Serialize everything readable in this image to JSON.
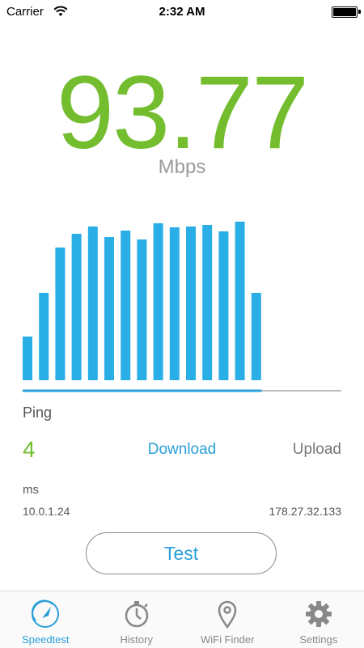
{
  "status_bar": {
    "carrier": "Carrier",
    "time": "2:32 AM"
  },
  "speed": {
    "value": "93.77",
    "unit": "Mbps"
  },
  "chart_data": {
    "type": "bar",
    "values": [
      54,
      108,
      164,
      181,
      190,
      177,
      185,
      174,
      194,
      189,
      190,
      192,
      184,
      196,
      108
    ],
    "progress": 0.75,
    "bar_color": "#2aaee6",
    "progress_color": "#2a9fd8",
    "track_color": "#bdbdbd"
  },
  "stats": {
    "ping_label": "Ping",
    "ping_value": "4",
    "download_label": "Download",
    "upload_label": "Upload",
    "ms_label": "ms",
    "local_ip": "10.0.1.24",
    "server_ip": "178.27.32.133"
  },
  "test_button": {
    "label": "Test"
  },
  "tabs": [
    {
      "label": "Speedtest",
      "icon": "speedtest-gauge-icon",
      "active": true
    },
    {
      "label": "History",
      "icon": "stopwatch-icon",
      "active": false
    },
    {
      "label": "WiFi Finder",
      "icon": "location-pin-icon",
      "active": false
    },
    {
      "label": "Settings",
      "icon": "gear-icon",
      "active": false
    }
  ],
  "colors": {
    "accent_green": "#73bd2f",
    "accent_blue": "#2a9fd8"
  }
}
